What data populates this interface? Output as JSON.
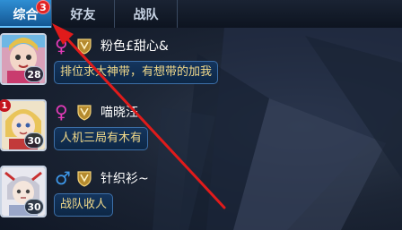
{
  "tabs": [
    {
      "label": "综合",
      "active": true,
      "badge": "3"
    },
    {
      "label": "好友",
      "active": false
    },
    {
      "label": "战队",
      "active": false
    }
  ],
  "friends": [
    {
      "gender": "female",
      "gender_symbol": "♀",
      "name": "粉色£甜心&",
      "level": "28",
      "status": "排位求大神带，有想带的加我",
      "rank_badge": ""
    },
    {
      "gender": "female",
      "gender_symbol": "♀",
      "name": "喵晓汪",
      "level": "30",
      "status": "人机三局有木有",
      "rank_badge": "1"
    },
    {
      "gender": "male",
      "gender_symbol": "♂",
      "name": "针织衫~",
      "level": "30",
      "status": "战队收人",
      "rank_badge": ""
    }
  ],
  "colors": {
    "accent": "#2f8fd4",
    "badge_red": "#e02424",
    "female": "#e23bb8",
    "male": "#3e98ea",
    "status_text": "#f1d98a",
    "annotation_arrow": "#e01b1b"
  },
  "icons": {
    "tier": "shield-crest-icon",
    "annotation": "red-arrow"
  }
}
